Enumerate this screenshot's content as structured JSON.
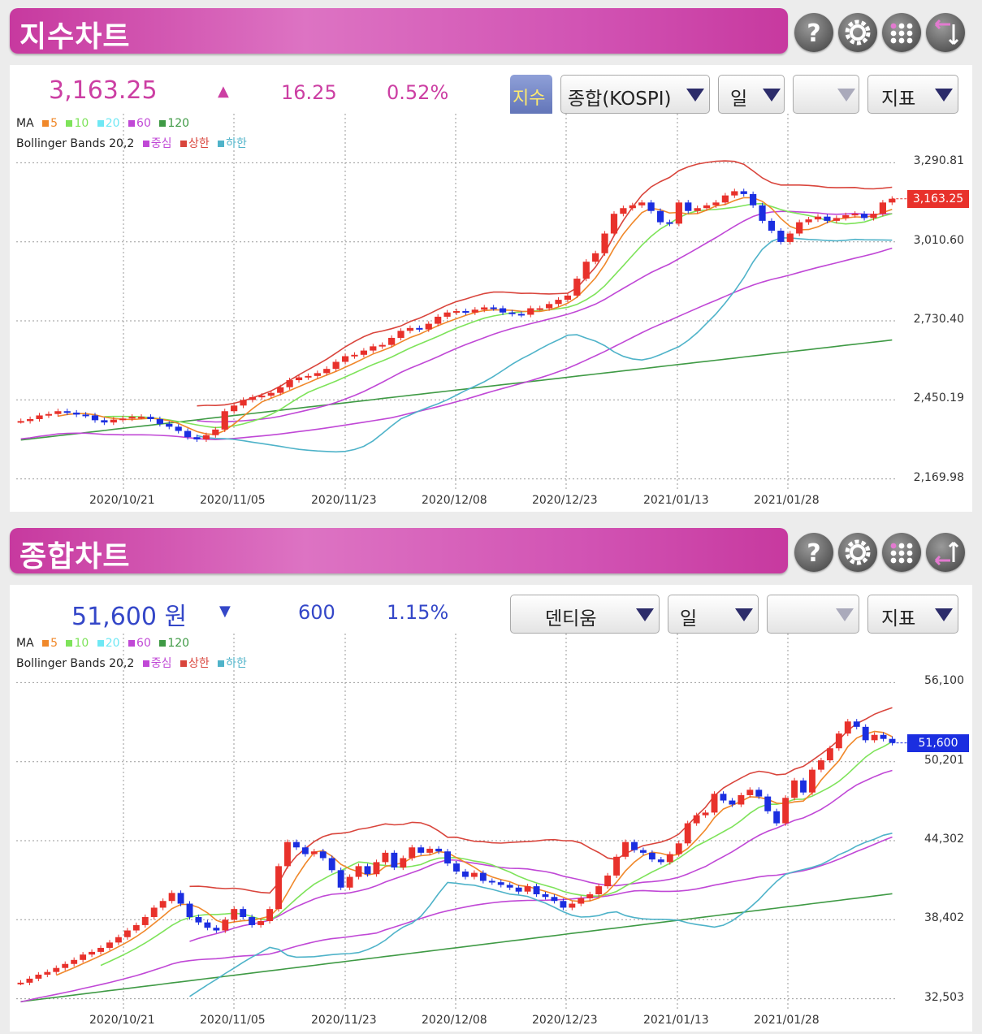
{
  "top": {
    "title": "지수차트",
    "price": "3,163.25",
    "arrow": "▲",
    "change": "16.25",
    "percent": "0.52%",
    "toggle_label": "지수",
    "select_market": "종합(KOSPI)",
    "select_period": "일",
    "select_empty": "",
    "select_indicator": "지표",
    "price_tag": "3,163.25",
    "yticks": [
      "3,290.81",
      "3,010.60",
      "2,730.40",
      "2,450.19",
      "2,169.98"
    ],
    "xticks": [
      "2020/10/21",
      "2020/11/05",
      "2020/11/23",
      "2020/12/08",
      "2020/12/23",
      "2021/01/13",
      "2021/01/28"
    ],
    "legend_ma": "MA",
    "legend_ma_items": [
      "5",
      "10",
      "20",
      "60",
      "120"
    ],
    "legend_bb": "Bollinger Bands 20,2",
    "legend_bb_items": [
      "중심",
      "상한",
      "하한"
    ]
  },
  "bottom": {
    "title": "종합차트",
    "price": "51,600 원",
    "arrow": "▼",
    "change": "600",
    "percent": "1.15%",
    "select_stock": "덴티움",
    "select_period": "일",
    "select_empty": "",
    "select_indicator": "지표",
    "price_tag": "51,600",
    "yticks": [
      "56,100",
      "50,201",
      "44,302",
      "38,402",
      "32,503"
    ],
    "xticks": [
      "2020/10/21",
      "2020/11/05",
      "2020/11/23",
      "2020/12/08",
      "2020/12/23",
      "2021/01/13",
      "2021/01/28"
    ],
    "legend_ma": "MA",
    "legend_ma_items": [
      "5",
      "10",
      "20",
      "60",
      "120"
    ],
    "legend_bb": "Bollinger Bands 20,2",
    "legend_bb_items": [
      "중심",
      "상한",
      "하한"
    ]
  },
  "colors": {
    "up": "#e8312b",
    "down": "#1b2ee0",
    "ma5": "#f0882a",
    "ma10": "#7ee35a",
    "ma20": "#6fe8f4",
    "ma60": "#c048d6",
    "ma120": "#3f9a45",
    "bb_mid": "#c048d6",
    "bb_up": "#d9453c",
    "bb_low": "#4fb3c9",
    "title_pink": "#cc3fa3",
    "price_blue": "#3447c8"
  },
  "chart_data": [
    {
      "type": "candlestick",
      "title": "지수차트",
      "ylim": [
        2169.98,
        3290.81
      ],
      "y_ticks": [
        3290.81,
        3010.6,
        2730.4,
        2450.19,
        2169.98
      ],
      "x_ticks": [
        "2020/10/21",
        "2020/11/05",
        "2020/11/23",
        "2020/12/08",
        "2020/12/23",
        "2021/01/13",
        "2021/01/28"
      ],
      "last": 3163.25,
      "close_series": [
        2375,
        2382,
        2395,
        2400,
        2410,
        2405,
        2398,
        2395,
        2378,
        2370,
        2380,
        2384,
        2390,
        2390,
        2382,
        2365,
        2355,
        2340,
        2318,
        2310,
        2325,
        2345,
        2410,
        2430,
        2450,
        2460,
        2465,
        2475,
        2495,
        2520,
        2530,
        2535,
        2545,
        2560,
        2585,
        2605,
        2610,
        2625,
        2640,
        2645,
        2670,
        2695,
        2705,
        2700,
        2720,
        2745,
        2760,
        2765,
        2760,
        2770,
        2778,
        2775,
        2760,
        2755,
        2752,
        2775,
        2775,
        2790,
        2805,
        2820,
        2880,
        2940,
        2970,
        3040,
        3110,
        3130,
        3140,
        3150,
        3120,
        3080,
        3075,
        3150,
        3120,
        3130,
        3140,
        3150,
        3175,
        3190,
        3180,
        3140,
        3085,
        3050,
        3010,
        3040,
        3080,
        3090,
        3100,
        3085,
        3095,
        3105,
        3110,
        3095,
        3110,
        3150,
        3163.25
      ]
    },
    {
      "type": "candlestick",
      "title": "종합차트",
      "ylim": [
        32503,
        56100
      ],
      "y_ticks": [
        56100,
        50201,
        44302,
        38402,
        32503
      ],
      "x_ticks": [
        "2020/10/21",
        "2020/11/05",
        "2020/11/23",
        "2020/12/08",
        "2020/12/23",
        "2021/01/13",
        "2021/01/28"
      ],
      "last": 51600,
      "close_series": [
        33700,
        34000,
        34300,
        34500,
        34800,
        35100,
        35400,
        35800,
        36000,
        36300,
        36700,
        37100,
        37600,
        38000,
        38600,
        39300,
        39800,
        40400,
        39600,
        38600,
        38200,
        37800,
        37600,
        38400,
        39200,
        38600,
        38000,
        38300,
        39200,
        42400,
        44200,
        43800,
        43300,
        43500,
        43000,
        42100,
        40800,
        41600,
        42400,
        41800,
        42700,
        43400,
        42300,
        43000,
        43800,
        43400,
        43700,
        43500,
        42600,
        42000,
        41600,
        41900,
        41300,
        41200,
        41000,
        40800,
        40500,
        40900,
        40300,
        40100,
        39800,
        39300,
        39600,
        40000,
        40300,
        40900,
        41700,
        43100,
        44200,
        43600,
        43400,
        42900,
        42700,
        43300,
        44100,
        45600,
        46200,
        46400,
        47800,
        47300,
        47000,
        47700,
        48100,
        47600,
        46500,
        45600,
        47500,
        48800,
        47900,
        49600,
        50300,
        51200,
        52300,
        53200,
        52800,
        51800,
        52200,
        51900,
        51600
      ]
    }
  ]
}
